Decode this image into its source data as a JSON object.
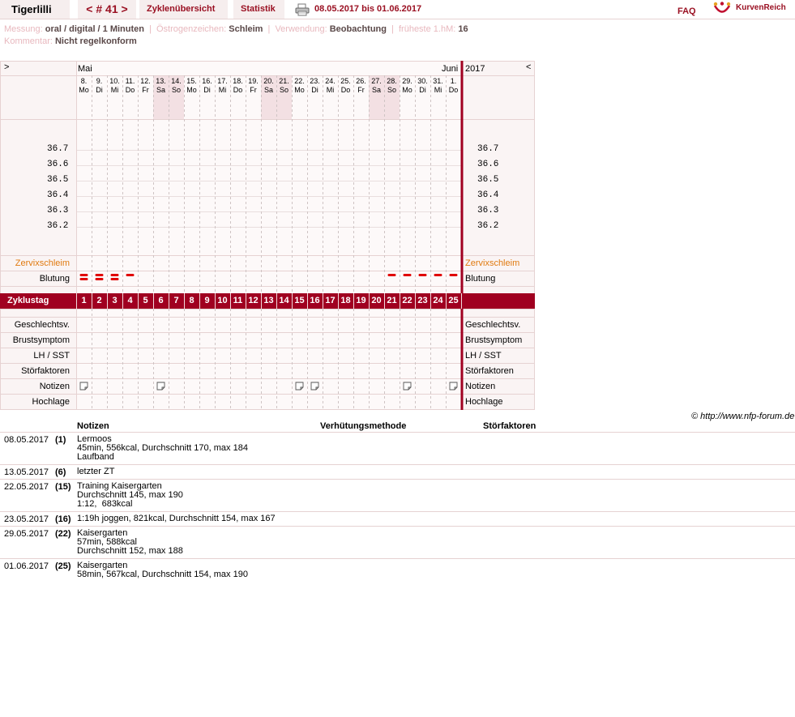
{
  "nav": {
    "username": "Tigerlilli",
    "cycle": "< # 41 >",
    "overview": "Zyklenübersicht",
    "statistics": "Statistik",
    "print_icon": "printer-icon",
    "date_range": "08.05.2017 bis 01.06.2017",
    "faq": "FAQ",
    "brand": "KurvenReich",
    "brand_icon": "kurvenreich-logo"
  },
  "info": {
    "measurement_label": "Messung:",
    "measurement_value": "oral / digital / 1 Minuten",
    "estrogen_label": "Östrogenzeichen:",
    "estrogen_value": "Schleim",
    "usage_label": "Verwendung:",
    "usage_value": "Beobachtung",
    "earliest_label": "früheste 1.hM:",
    "earliest_value": "16",
    "comment_label": "Kommentar:",
    "comment_value": "Nicht regelkonform"
  },
  "chart": {
    "nav_right": ">",
    "nav_left": "<",
    "month_start": "Mai",
    "month_end": "Juni",
    "year": "2017",
    "days": [
      {
        "d": "8.",
        "w": "Mo",
        "we": false
      },
      {
        "d": "9.",
        "w": "Di",
        "we": false
      },
      {
        "d": "10.",
        "w": "Mi",
        "we": false
      },
      {
        "d": "11.",
        "w": "Do",
        "we": false
      },
      {
        "d": "12.",
        "w": "Fr",
        "we": false
      },
      {
        "d": "13.",
        "w": "Sa",
        "we": true
      },
      {
        "d": "14.",
        "w": "So",
        "we": true
      },
      {
        "d": "15.",
        "w": "Mo",
        "we": false
      },
      {
        "d": "16.",
        "w": "Di",
        "we": false
      },
      {
        "d": "17.",
        "w": "Mi",
        "we": false
      },
      {
        "d": "18.",
        "w": "Do",
        "we": false
      },
      {
        "d": "19.",
        "w": "Fr",
        "we": false
      },
      {
        "d": "20.",
        "w": "Sa",
        "we": true
      },
      {
        "d": "21.",
        "w": "So",
        "we": true
      },
      {
        "d": "22.",
        "w": "Mo",
        "we": false
      },
      {
        "d": "23.",
        "w": "Di",
        "we": false
      },
      {
        "d": "24.",
        "w": "Mi",
        "we": false
      },
      {
        "d": "25.",
        "w": "Do",
        "we": false
      },
      {
        "d": "26.",
        "w": "Fr",
        "we": false
      },
      {
        "d": "27.",
        "w": "Sa",
        "we": true
      },
      {
        "d": "28.",
        "w": "So",
        "we": true
      },
      {
        "d": "29.",
        "w": "Mo",
        "we": false
      },
      {
        "d": "30.",
        "w": "Di",
        "we": false
      },
      {
        "d": "31.",
        "w": "Mi",
        "we": false
      },
      {
        "d": "1.",
        "w": "Do",
        "we": false
      }
    ],
    "temperatures": [
      "36.7",
      "36.6",
      "36.5",
      "36.4",
      "36.3",
      "36.2"
    ],
    "cervix_label": "Zervixschleim",
    "bleeding_label": "Blutung",
    "bleeding": [
      2,
      2,
      2,
      1,
      0,
      0,
      0,
      0,
      0,
      0,
      0,
      0,
      0,
      0,
      0,
      0,
      0,
      0,
      0,
      0,
      1,
      1,
      1,
      1,
      1
    ],
    "cycle_day_label": "Zyklustag",
    "cycle_days": [
      "1",
      "2",
      "3",
      "4",
      "5",
      "6",
      "7",
      "8",
      "9",
      "10",
      "11",
      "12",
      "13",
      "14",
      "15",
      "16",
      "17",
      "18",
      "19",
      "20",
      "21",
      "22",
      "23",
      "24",
      "25"
    ],
    "rows_bottom": [
      "Geschlechtsv.",
      "Brustsymptom",
      "LH / SST",
      "Störfaktoren",
      "Notizen",
      "Hochlage"
    ],
    "notes_on_days": [
      1,
      6,
      15,
      16,
      22,
      25
    ],
    "note_icon": "note-icon",
    "colors": {
      "accent": "#a00020",
      "cervix_text": "#e07a10",
      "bleeding_mark": "#e00000",
      "weekend_fill": "#f3e0e3",
      "panel_fill": "#faf4f4"
    }
  },
  "credit": "© http://www.nfp-forum.de",
  "notes_table": {
    "headers": [
      "Notizen",
      "Verhütungsmethode",
      "Störfaktoren"
    ],
    "rows": [
      {
        "date": "08.05.2017",
        "day": "(1)",
        "lines": [
          "Lermoos",
          "45min, 556kcal, Durchschnitt 170, max 184",
          "Laufband"
        ]
      },
      {
        "date": "13.05.2017",
        "day": "(6)",
        "lines": [
          "letzter ZT"
        ]
      },
      {
        "date": "22.05.2017",
        "day": "(15)",
        "lines": [
          "Training Kaisergarten",
          "Durchschnitt 145, max 190",
          "1:12,  683kcal"
        ]
      },
      {
        "date": "23.05.2017",
        "day": "(16)",
        "lines": [
          "1:19h joggen, 821kcal, Durchschnitt 154, max 167"
        ]
      },
      {
        "date": "29.05.2017",
        "day": "(22)",
        "lines": [
          "Kaisergarten",
          "57min, 588kcal",
          "Durchschnitt 152, max 188"
        ]
      },
      {
        "date": "01.06.2017",
        "day": "(25)",
        "lines": [
          "Kaisergarten",
          "58min, 567kcal, Durchschnitt 154, max 190"
        ]
      }
    ]
  }
}
